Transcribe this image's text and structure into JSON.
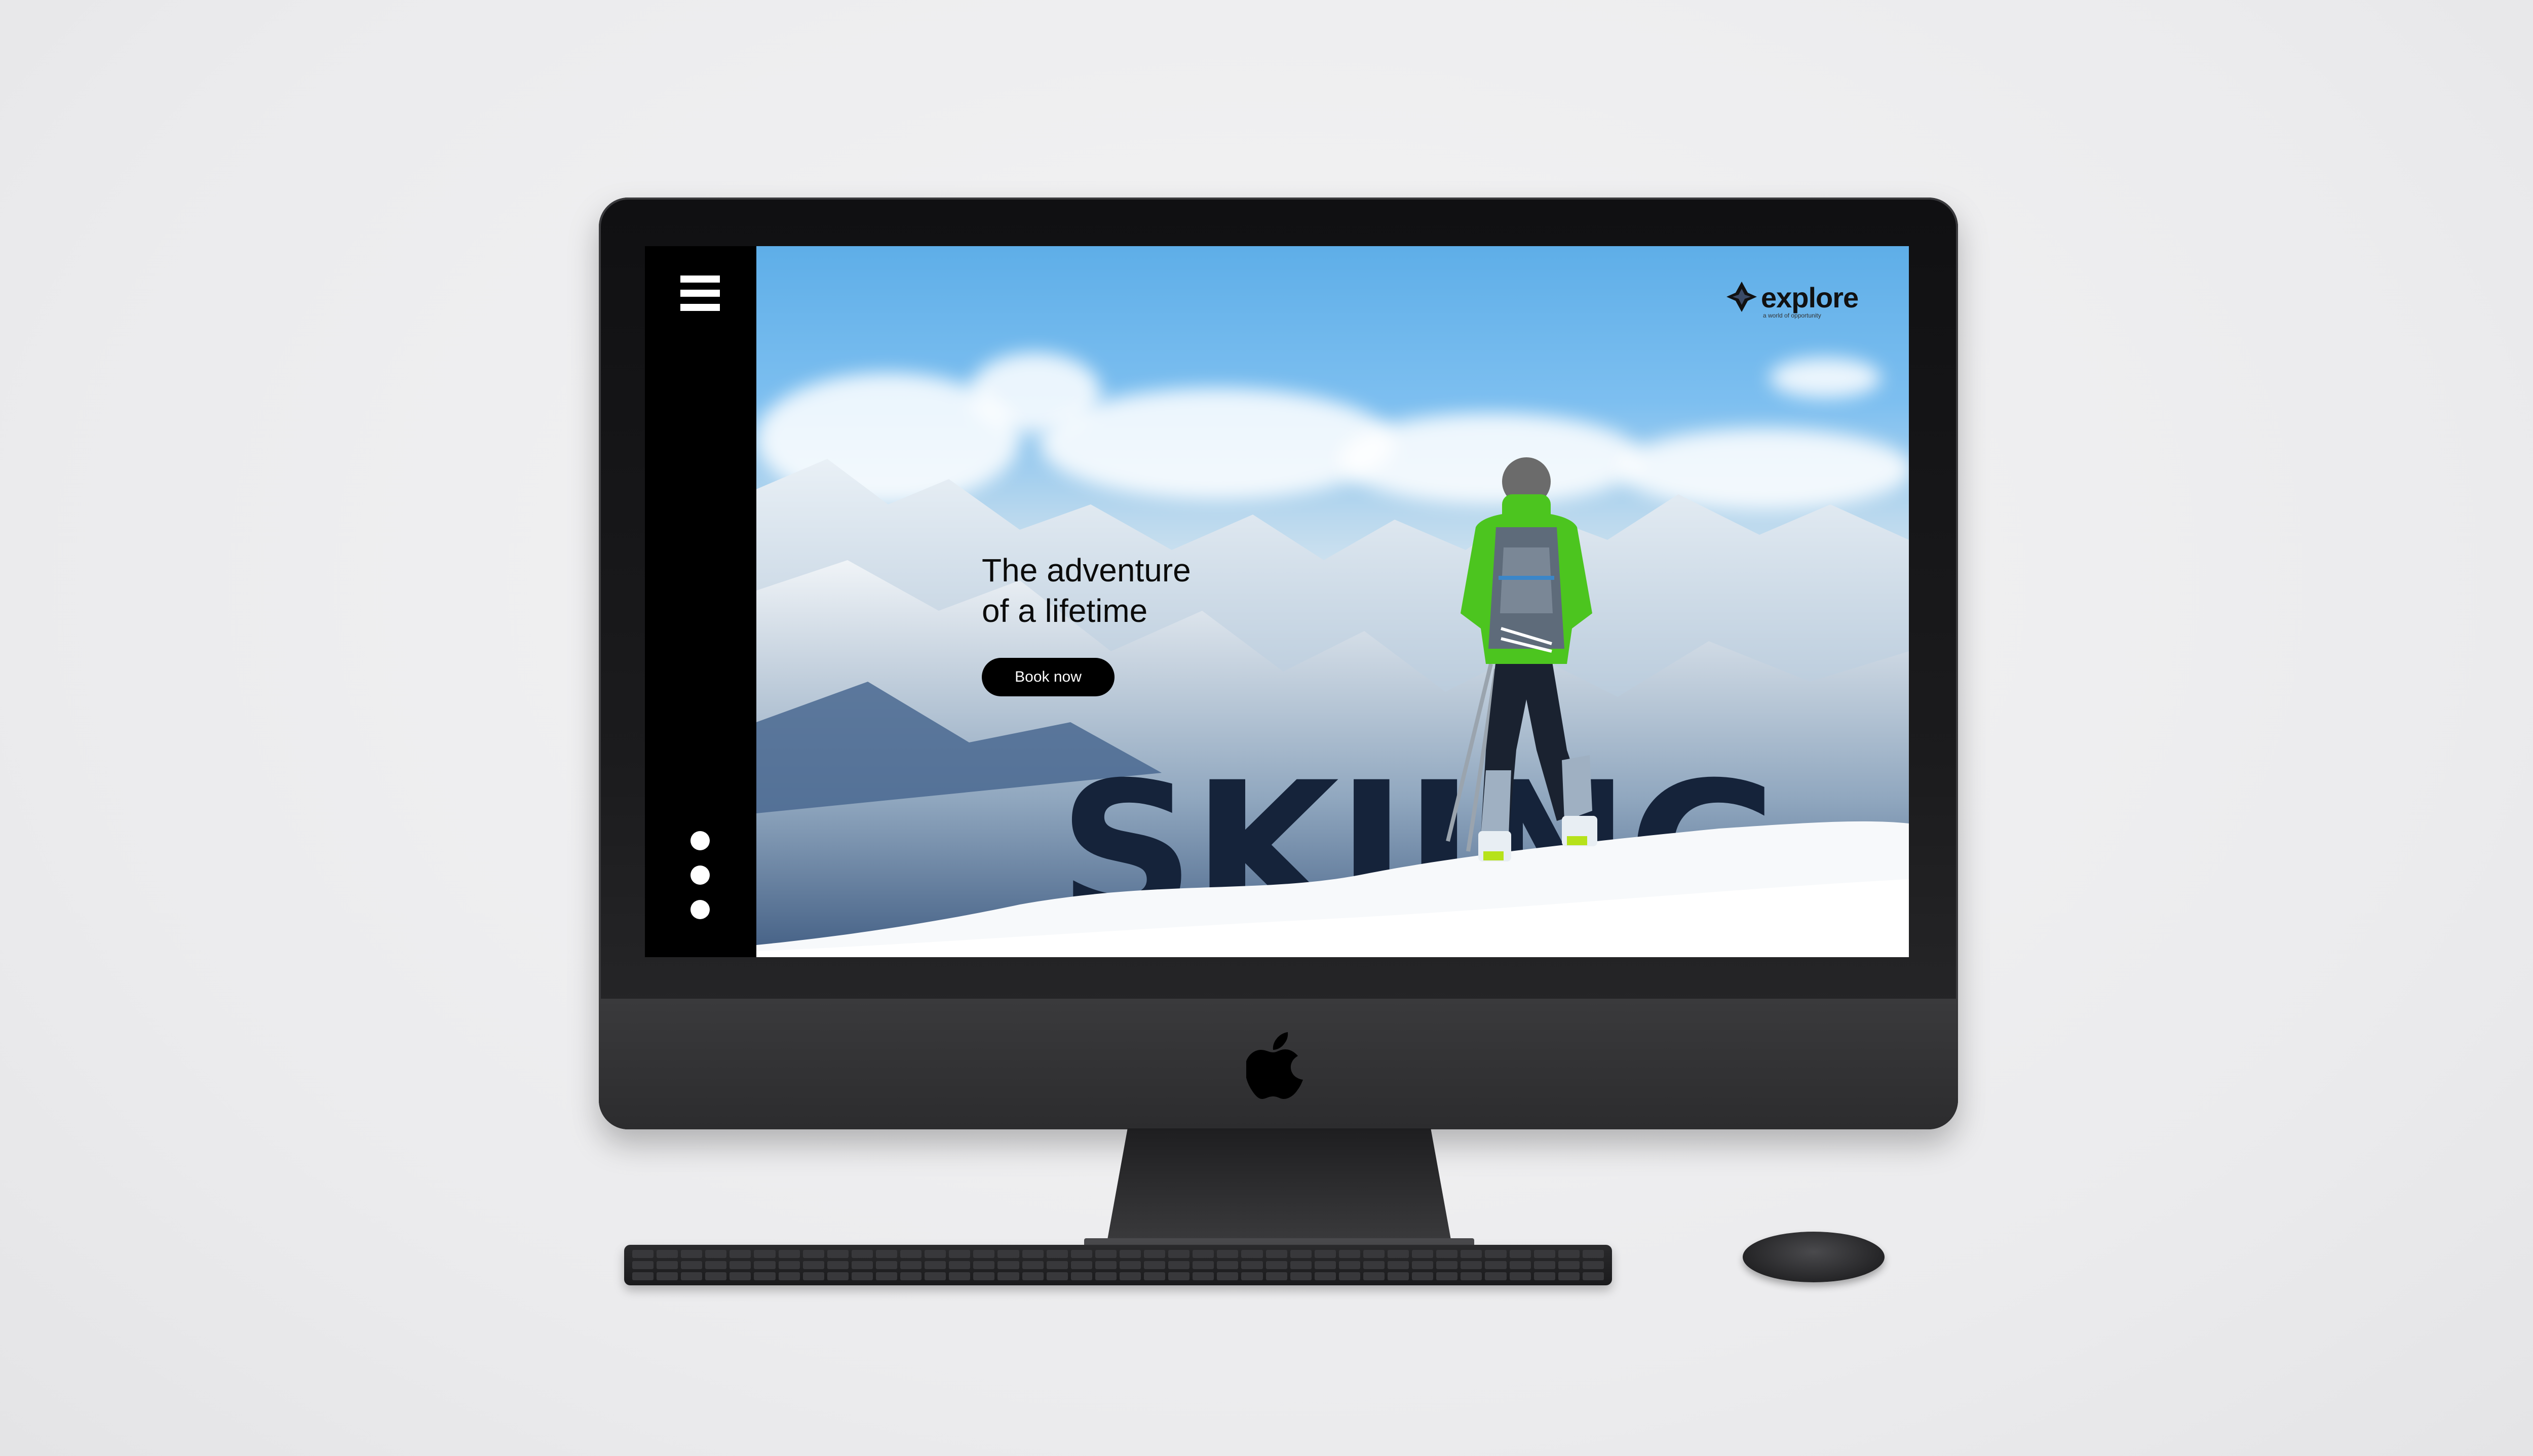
{
  "brand": {
    "name": "explore",
    "tagline": "a world of opportunity"
  },
  "hero": {
    "headline_line1": "The adventure",
    "headline_line2": "of a lifetime",
    "cta_label": "Book now",
    "big_title": "SKIING"
  },
  "sidebar": {
    "menu_icon": "hamburger-menu-icon",
    "more_icon": "vertical-dots-icon"
  },
  "colors": {
    "sidebar_bg": "#000000",
    "cta_bg": "#000000",
    "big_title": "#15233a",
    "jacket_green": "#4cc51f"
  }
}
